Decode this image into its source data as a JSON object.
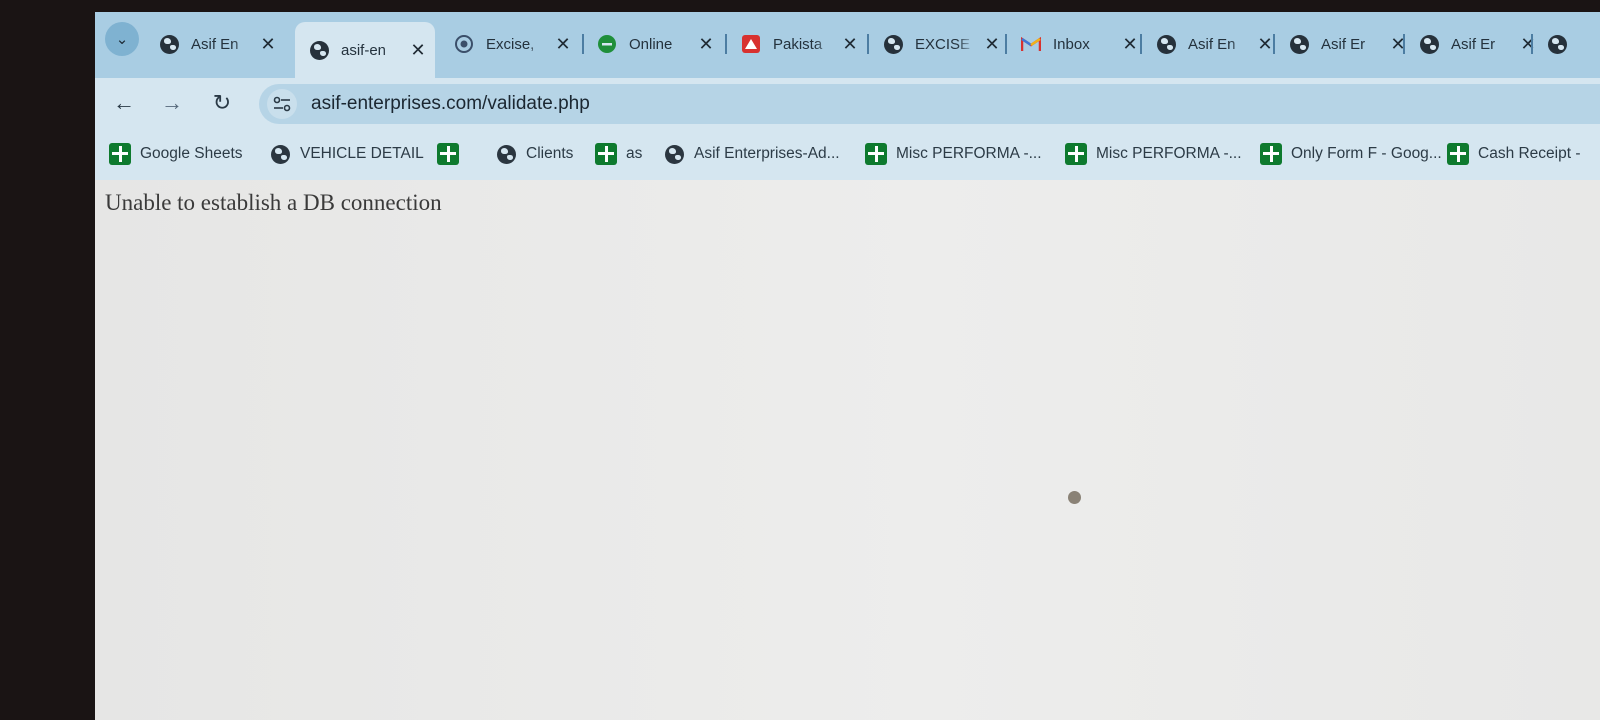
{
  "tabs": [
    {
      "label": "Asif En",
      "icon": "globe-icon",
      "active": false
    },
    {
      "label": "asif-en",
      "icon": "globe-icon",
      "active": true
    },
    {
      "label": "Excise,",
      "icon": "emblem-icon",
      "active": false
    },
    {
      "label": "Online",
      "icon": "edge-icon",
      "active": false
    },
    {
      "label": "Pakista",
      "icon": "red-logo-icon",
      "active": false
    },
    {
      "label": "EXCISE",
      "icon": "globe-icon",
      "active": false
    },
    {
      "label": "Inbox",
      "icon": "gmail-icon",
      "active": false
    },
    {
      "label": "Asif En",
      "icon": "globe-icon",
      "active": false
    },
    {
      "label": "Asif Er",
      "icon": "globe-icon",
      "active": false
    },
    {
      "label": "Asif Er",
      "icon": "globe-icon",
      "active": false
    }
  ],
  "close_glyph": "✕",
  "address_bar": {
    "url": "asif-enterprises.com/validate.php"
  },
  "bookmarks": [
    {
      "label": "Google Sheets",
      "icon": "sheets-icon"
    },
    {
      "label": "VEHICLE DETAIL",
      "icon": "globe-icon"
    },
    {
      "label": "",
      "icon": "sheets-icon"
    },
    {
      "label": "Clients",
      "icon": "globe-icon"
    },
    {
      "label": "as",
      "icon": "sheets-icon"
    },
    {
      "label": "Asif Enterprises-Ad...",
      "icon": "globe-icon"
    },
    {
      "label": "Misc PERFORMA -...",
      "icon": "sheets-icon"
    },
    {
      "label": "Misc PERFORMA -...",
      "icon": "sheets-icon"
    },
    {
      "label": "Only Form F - Goog...",
      "icon": "sheets-icon"
    },
    {
      "label": "Cash Receipt -",
      "icon": "sheets-icon"
    }
  ],
  "page": {
    "message": "Unable to establish a DB connection"
  },
  "colors": {
    "tab_strip": "#a9cde3",
    "toolbar": "#d5e6f0",
    "omnibox": "#b6d4e6",
    "sheets_green": "#0e7a2e"
  }
}
